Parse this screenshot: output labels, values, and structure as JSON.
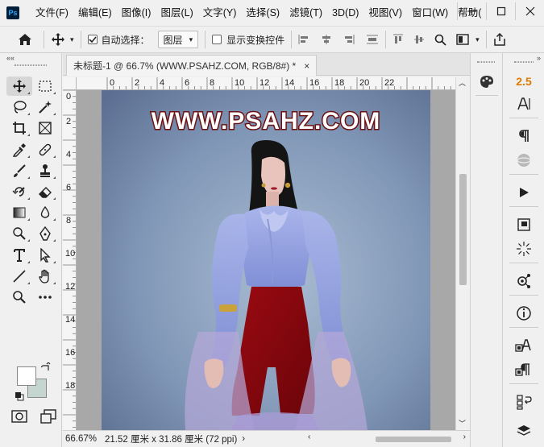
{
  "app": {
    "logo_text": "Ps",
    "menu": [
      "文件(F)",
      "编辑(E)",
      "图像(I)",
      "图层(L)",
      "文字(Y)",
      "选择(S)",
      "滤镜(T)",
      "3D(D)",
      "视图(V)",
      "窗口(W)",
      "帮助("
    ]
  },
  "options": {
    "auto_select_label": "自动选择：",
    "auto_select_checked": true,
    "layer_dropdown": "图层",
    "show_transform_label": "显示变换控件",
    "show_transform_checked": false
  },
  "document": {
    "tab_title": "未标题-1 @ 66.7% (WWW.PSAHZ.COM, RGB/8#) *",
    "close_glyph": "×",
    "watermark": "WWW.PSAHZ.COM"
  },
  "rulers": {
    "horizontal": [
      "0",
      "2",
      "4",
      "6",
      "8",
      "10",
      "12",
      "14",
      "16",
      "18",
      "20",
      "22"
    ],
    "vertical": [
      "0",
      "2",
      "4",
      "6",
      "8",
      "10",
      "12",
      "14",
      "16",
      "18"
    ]
  },
  "status": {
    "zoom": "66.67%",
    "doc_size": "21.52 厘米 x 31.86 厘米 (72 ppi)",
    "arrow": "›"
  },
  "panels": {
    "size_value": "2.5"
  },
  "colors": {
    "foreground": "#ffffff",
    "background": "#c5d6d0",
    "accent_orange": "#e07a00"
  }
}
